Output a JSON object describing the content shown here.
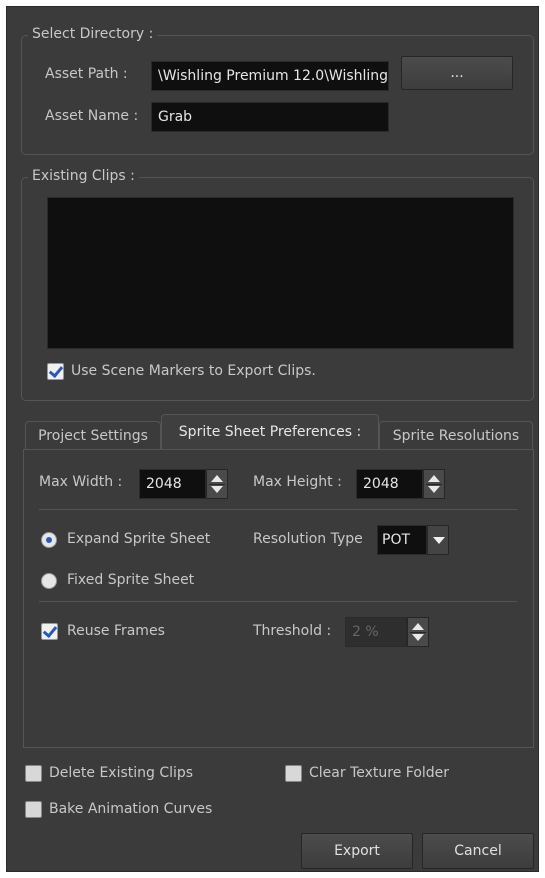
{
  "select_directory": {
    "title": "Select Directory :",
    "asset_path_label": "Asset Path :",
    "asset_path_value": "\\Wishling Premium 12.0\\Wishling",
    "browse_label": "...",
    "asset_name_label": "Asset Name :",
    "asset_name_value": "Grab"
  },
  "existing_clips": {
    "title": "Existing Clips :",
    "use_scene_markers_label": "Use Scene Markers to Export Clips.",
    "use_scene_markers_checked": true
  },
  "tabs": [
    {
      "label": "Project Settings",
      "active": false
    },
    {
      "label": "Sprite Sheet Preferences :",
      "active": true
    },
    {
      "label": "Sprite Resolutions",
      "active": false
    }
  ],
  "sprite_sheet": {
    "max_width_label": "Max Width :",
    "max_width_value": "2048",
    "max_height_label": "Max Height :",
    "max_height_value": "2048",
    "expand_label": "Expand Sprite Sheet",
    "expand_selected": true,
    "fixed_label": "Fixed Sprite Sheet",
    "resolution_type_label": "Resolution Type",
    "resolution_type_value": "POT",
    "reuse_frames_label": "Reuse Frames",
    "reuse_frames_checked": true,
    "threshold_label": "Threshold :",
    "threshold_value": "2 %"
  },
  "options": {
    "delete_existing_label": "Delete Existing Clips",
    "clear_texture_label": "Clear Texture Folder",
    "bake_curves_label": "Bake Animation Curves"
  },
  "buttons": {
    "export_label": "Export",
    "cancel_label": "Cancel"
  },
  "colors": {
    "dialog_bg": "#3b3b3b",
    "field_bg": "#0f0f0f",
    "accent": "#2a5ab8"
  }
}
